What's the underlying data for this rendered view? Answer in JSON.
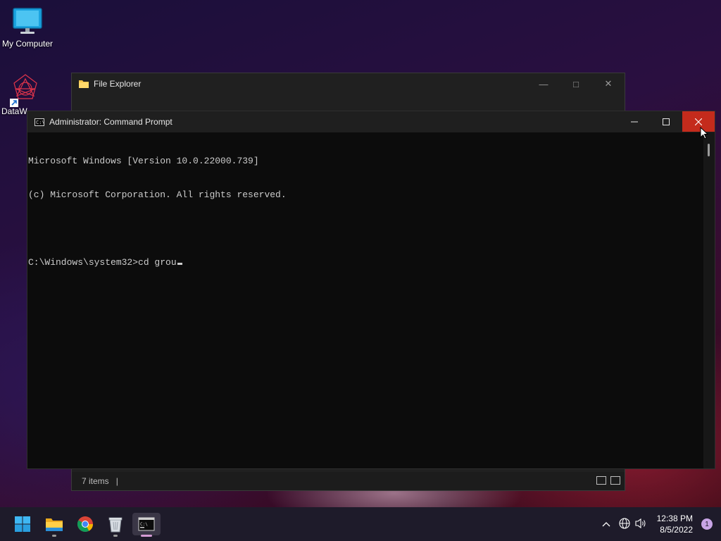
{
  "desktop": {
    "icons": [
      {
        "label": "My Computer",
        "icon": "monitor-icon"
      },
      {
        "label": "DataW",
        "icon": "datawrapper-shortcut-icon"
      }
    ]
  },
  "file_explorer": {
    "title": "File Explorer",
    "status_items": "7 items",
    "status_separator": "|"
  },
  "cmd": {
    "title": "Administrator: Command Prompt",
    "lines": [
      "Microsoft Windows [Version 10.0.22000.739]",
      "(c) Microsoft Corporation. All rights reserved.",
      "",
      "C:\\Windows\\system32>cd grou"
    ]
  },
  "taskbar": {
    "apps": [
      {
        "name": "start",
        "icon": "windows-start-icon"
      },
      {
        "name": "file-explorer",
        "icon": "folder-icon"
      },
      {
        "name": "chrome",
        "icon": "chrome-icon"
      },
      {
        "name": "recycle",
        "icon": "recycle-bin-icon"
      },
      {
        "name": "command-prompt",
        "icon": "terminal-icon"
      }
    ],
    "clock_time": "12:38 PM",
    "clock_date": "8/5/2022",
    "notification_count": "1"
  },
  "colors": {
    "close_hover": "#c42b1c",
    "console_bg": "#0c0c0c",
    "console_fg": "#cccccc",
    "taskbar_bg": "#1e1b2a"
  }
}
